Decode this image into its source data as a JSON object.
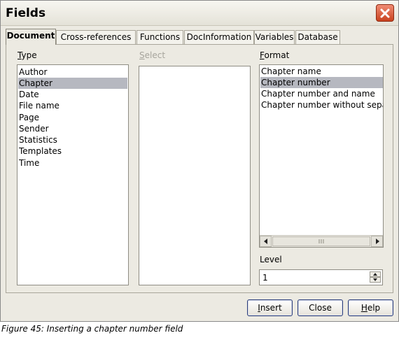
{
  "window": {
    "title": "Fields",
    "close_icon": "close-icon"
  },
  "tabs": [
    {
      "label": "Document",
      "active": true
    },
    {
      "label": "Cross-references",
      "active": false
    },
    {
      "label": "Functions",
      "active": false
    },
    {
      "label": "DocInformation",
      "active": false
    },
    {
      "label": "Variables",
      "active": false
    },
    {
      "label": "Database",
      "active": false
    }
  ],
  "type": {
    "label": "Type",
    "items": [
      "Author",
      "Chapter",
      "Date",
      "File name",
      "Page",
      "Sender",
      "Statistics",
      "Templates",
      "Time"
    ],
    "selected": "Chapter"
  },
  "select": {
    "label": "Select",
    "items": []
  },
  "format": {
    "label": "Format",
    "items": [
      "Chapter name",
      "Chapter number",
      "Chapter number and name",
      "Chapter number without separator"
    ],
    "selected": "Chapter number"
  },
  "level": {
    "label": "Level",
    "value": "1"
  },
  "buttons": {
    "insert": "Insert",
    "close": "Close",
    "help": "Help"
  },
  "caption": "Figure 45: Inserting a chapter number field",
  "colors": {
    "dialog_bg": "#eceae2",
    "selection": "#b6b8c0",
    "close_button": "#c9421f"
  }
}
